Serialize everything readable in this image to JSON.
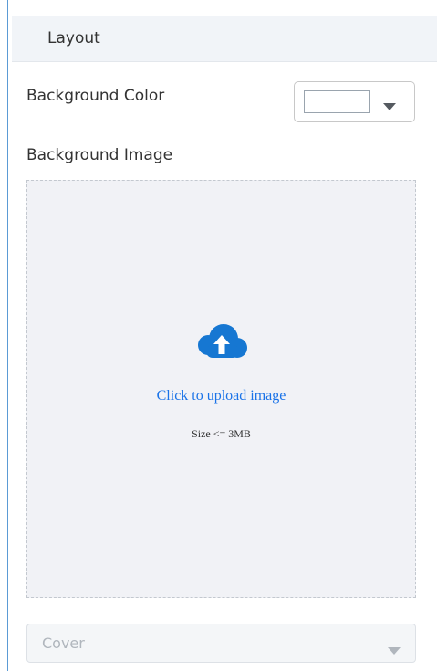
{
  "layout_section": {
    "title": "Layout"
  },
  "background_color": {
    "label": "Background Color",
    "value": "#ffffff",
    "dropdown_icon": "caret-down-icon"
  },
  "background_image": {
    "label": "Background Image",
    "upload_icon": "cloud-upload-icon",
    "upload_text": "Click to upload image",
    "size_limit": "Size <= 3MB"
  },
  "image_size_select": {
    "value": "Cover",
    "dropdown_icon": "caret-down-icon"
  },
  "colors": {
    "accent": "#1a73e8",
    "cloud_icon": "#1677d2",
    "panel_border": "#5b9bd5"
  }
}
